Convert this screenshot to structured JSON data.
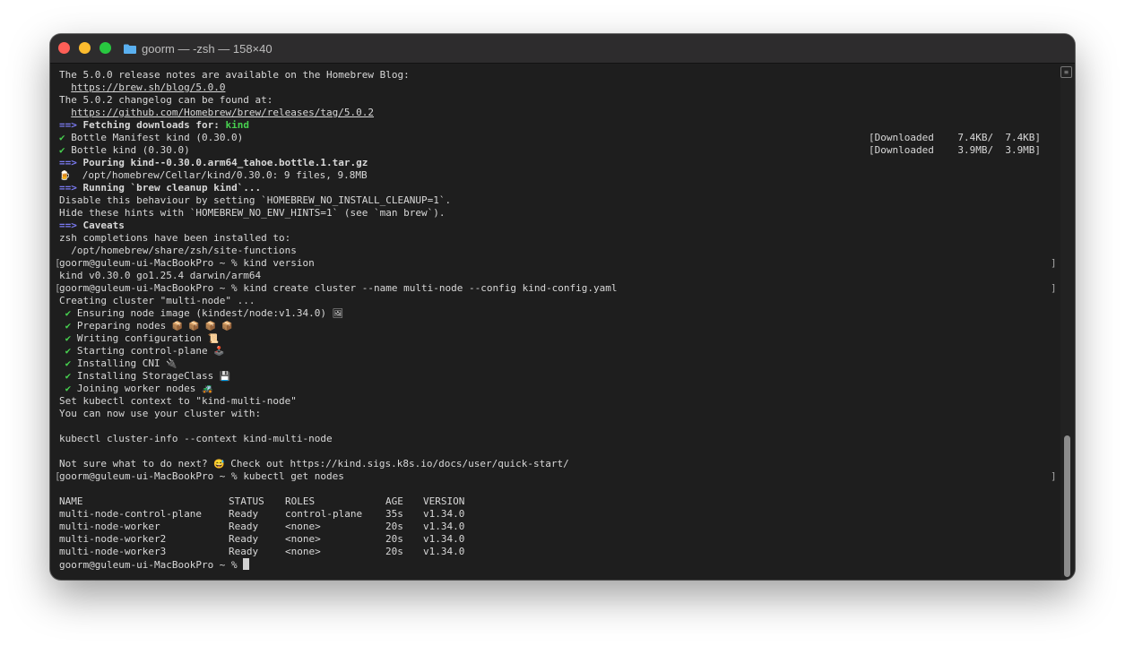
{
  "window": {
    "title": "goorm — -zsh — 158×40",
    "colors": {
      "background": "#1e1e1e",
      "text": "#d8d8d8",
      "arrow": "#7b7bf3",
      "check": "#47d04f"
    }
  },
  "terminal": {
    "release_notes_text": "The 5.0.0 release notes are available on the Homebrew Blog:",
    "release_notes_url": "https://brew.sh/blog/5.0.0",
    "changelog_text": "The 5.0.2 changelog can be found at:",
    "changelog_url": "https://github.com/Homebrew/brew/releases/tag/5.0.2",
    "arrow": "==>",
    "check": "✔",
    "fetching_label": "Fetching downloads for:",
    "fetching_pkg": "kind",
    "manifest_line": "Bottle Manifest kind (0.30.0)",
    "manifest_status": "[Downloaded    7.4KB/  7.4KB]",
    "bottle_line": "Bottle kind (0.30.0)",
    "bottle_status": "[Downloaded    3.9MB/  3.9MB]",
    "pouring": "Pouring kind--0.30.0.arm64_tahoe.bottle.1.tar.gz",
    "beer_emoji": "🍺",
    "cellar_line": "/opt/homebrew/Cellar/kind/0.30.0: 9 files, 9.8MB",
    "cleanup": "Running `brew cleanup kind`...",
    "disable_line": "Disable this behaviour by setting `HOMEBREW_NO_INSTALL_CLEANUP=1`.",
    "hide_line": "Hide these hints with `HOMEBREW_NO_ENV_HINTS=1` (see `man brew`).",
    "caveats": "Caveats",
    "zsh_completions": "zsh completions have been installed to:",
    "site_functions": "  /opt/homebrew/share/zsh/site-functions",
    "prompt": "goorm@guleum-ui-MacBookPro ~ %",
    "cmd_version": "kind version",
    "version_output": "kind v0.30.0 go1.25.4 darwin/arm64",
    "cmd_create": "kind create cluster --name multi-node --config kind-config.yaml",
    "creating": "Creating cluster \"multi-node\" ...",
    "steps": [
      {
        "text": "Ensuring node image (kindest/node:v1.34.0)",
        "emoji": "🖼"
      },
      {
        "text": "Preparing nodes",
        "emoji": "📦 📦 📦 📦"
      },
      {
        "text": "Writing configuration",
        "emoji": "📜"
      },
      {
        "text": "Starting control-plane",
        "emoji": "🕹️"
      },
      {
        "text": "Installing CNI",
        "emoji": "🔌"
      },
      {
        "text": "Installing StorageClass",
        "emoji": "💾"
      },
      {
        "text": "Joining worker nodes",
        "emoji": "🚜"
      }
    ],
    "set_context": "Set kubectl context to \"kind-multi-node\"",
    "you_can_use": "You can now use your cluster with:",
    "cluster_info_cmd": "kubectl cluster-info --context kind-multi-node",
    "not_sure": "Not sure what to do next?",
    "smile_emoji": "😅",
    "check_out": " Check out https://kind.sigs.k8s.io/docs/user/quick-start/",
    "cmd_get_nodes": "kubectl get nodes",
    "right_bracket": "]",
    "left_bracket": "[",
    "table": {
      "headers": [
        "NAME",
        "STATUS",
        "ROLES",
        "AGE",
        "VERSION"
      ],
      "rows": [
        [
          "multi-node-control-plane",
          "Ready",
          "control-plane",
          "35s",
          "v1.34.0"
        ],
        [
          "multi-node-worker",
          "Ready",
          "<none>",
          "20s",
          "v1.34.0"
        ],
        [
          "multi-node-worker2",
          "Ready",
          "<none>",
          "20s",
          "v1.34.0"
        ],
        [
          "multi-node-worker3",
          "Ready",
          "<none>",
          "20s",
          "v1.34.0"
        ]
      ]
    }
  },
  "scrollbar": {
    "icon": "scroll-marker-icon",
    "marker_glyph": "≡"
  }
}
